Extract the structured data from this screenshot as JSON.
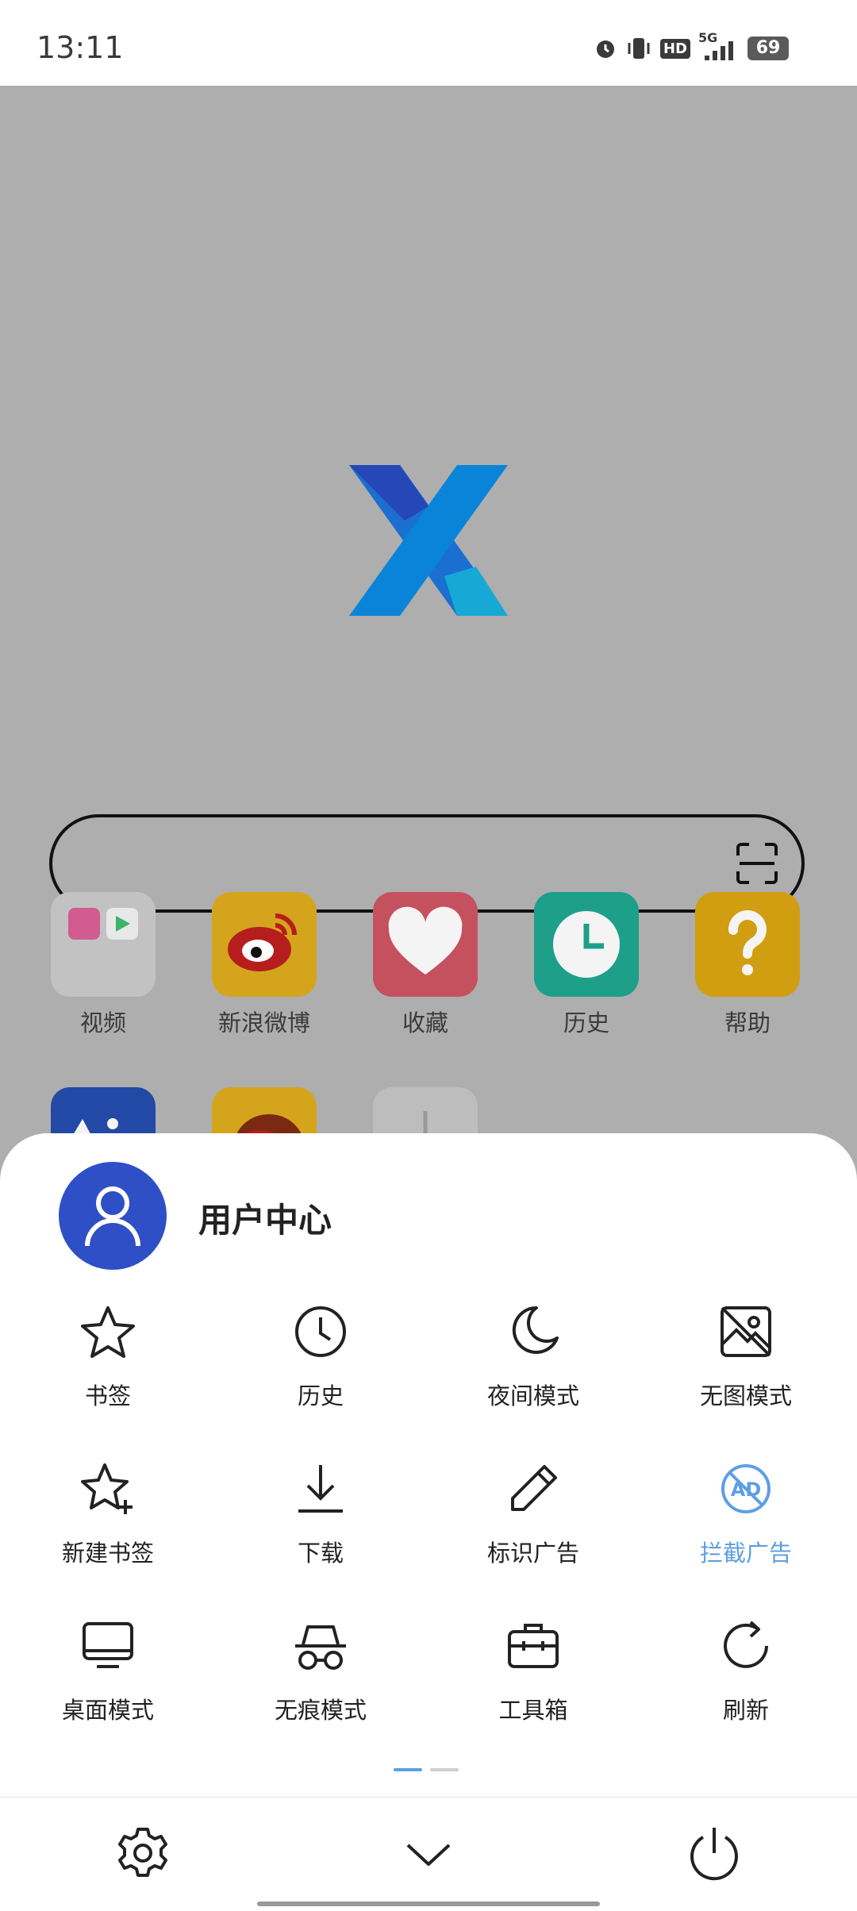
{
  "status": {
    "time": "13:11",
    "battery": "69",
    "network": "5G",
    "hd": "HD"
  },
  "quick_links": [
    {
      "label": "视频",
      "icon": "video-folder-icon",
      "color": "#c2c2c2"
    },
    {
      "label": "新浪微博",
      "icon": "weibo-icon",
      "color": "#d4a51c"
    },
    {
      "label": "收藏",
      "icon": "heart-icon",
      "color": "#c5515f"
    },
    {
      "label": "历史",
      "icon": "clock-icon",
      "color": "#1d9f8a"
    },
    {
      "label": "帮助",
      "icon": "question-icon",
      "color": "#d09e10"
    }
  ],
  "user_center": {
    "label": "用户中心"
  },
  "menu": [
    {
      "label": "书签",
      "icon": "star-icon"
    },
    {
      "label": "历史",
      "icon": "clock-icon"
    },
    {
      "label": "夜间模式",
      "icon": "moon-icon"
    },
    {
      "label": "无图模式",
      "icon": "no-image-icon"
    },
    {
      "label": "新建书签",
      "icon": "star-plus-icon"
    },
    {
      "label": "下载",
      "icon": "download-icon"
    },
    {
      "label": "标识广告",
      "icon": "pencil-icon"
    },
    {
      "label": "拦截广告",
      "icon": "ad-block-icon",
      "active": true
    },
    {
      "label": "桌面模式",
      "icon": "monitor-icon"
    },
    {
      "label": "无痕模式",
      "icon": "incognito-icon"
    },
    {
      "label": "工具箱",
      "icon": "toolbox-icon"
    },
    {
      "label": "刷新",
      "icon": "refresh-icon"
    }
  ],
  "colors": {
    "accent": "#5d9fe3",
    "avatar": "#2f4fc6"
  }
}
